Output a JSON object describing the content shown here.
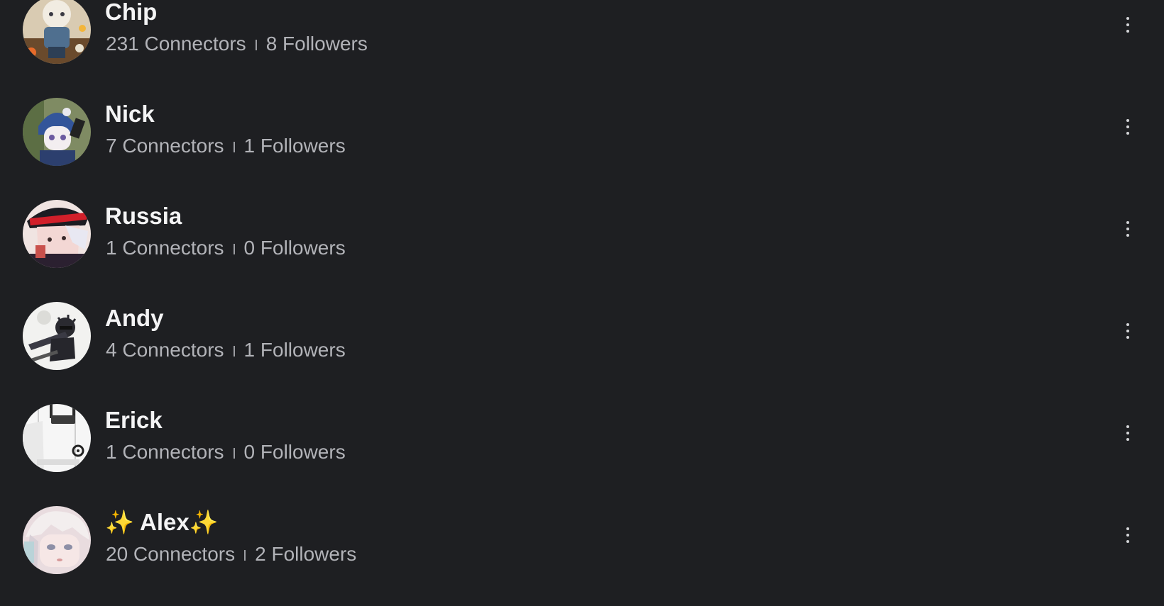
{
  "users": [
    {
      "name": "Chip",
      "connectors": "231 Connectors",
      "followers": "8 Followers"
    },
    {
      "name": "Nick",
      "connectors": "7 Connectors",
      "followers": "1 Followers"
    },
    {
      "name": "Russia",
      "connectors": "1 Connectors",
      "followers": "0 Followers"
    },
    {
      "name": "Andy",
      "connectors": "4 Connectors",
      "followers": "1 Followers"
    },
    {
      "name": "Erick",
      "connectors": "1 Connectors",
      "followers": "0 Followers"
    },
    {
      "name": "✨ Alex✨",
      "connectors": "20 Connectors",
      "followers": "2 Followers"
    }
  ],
  "icons": {
    "row_action": "more-vertical-icon"
  },
  "colors": {
    "background": "#1e1f22",
    "name_text": "#f4f4f5",
    "stats_text": "#b2b3b8"
  }
}
